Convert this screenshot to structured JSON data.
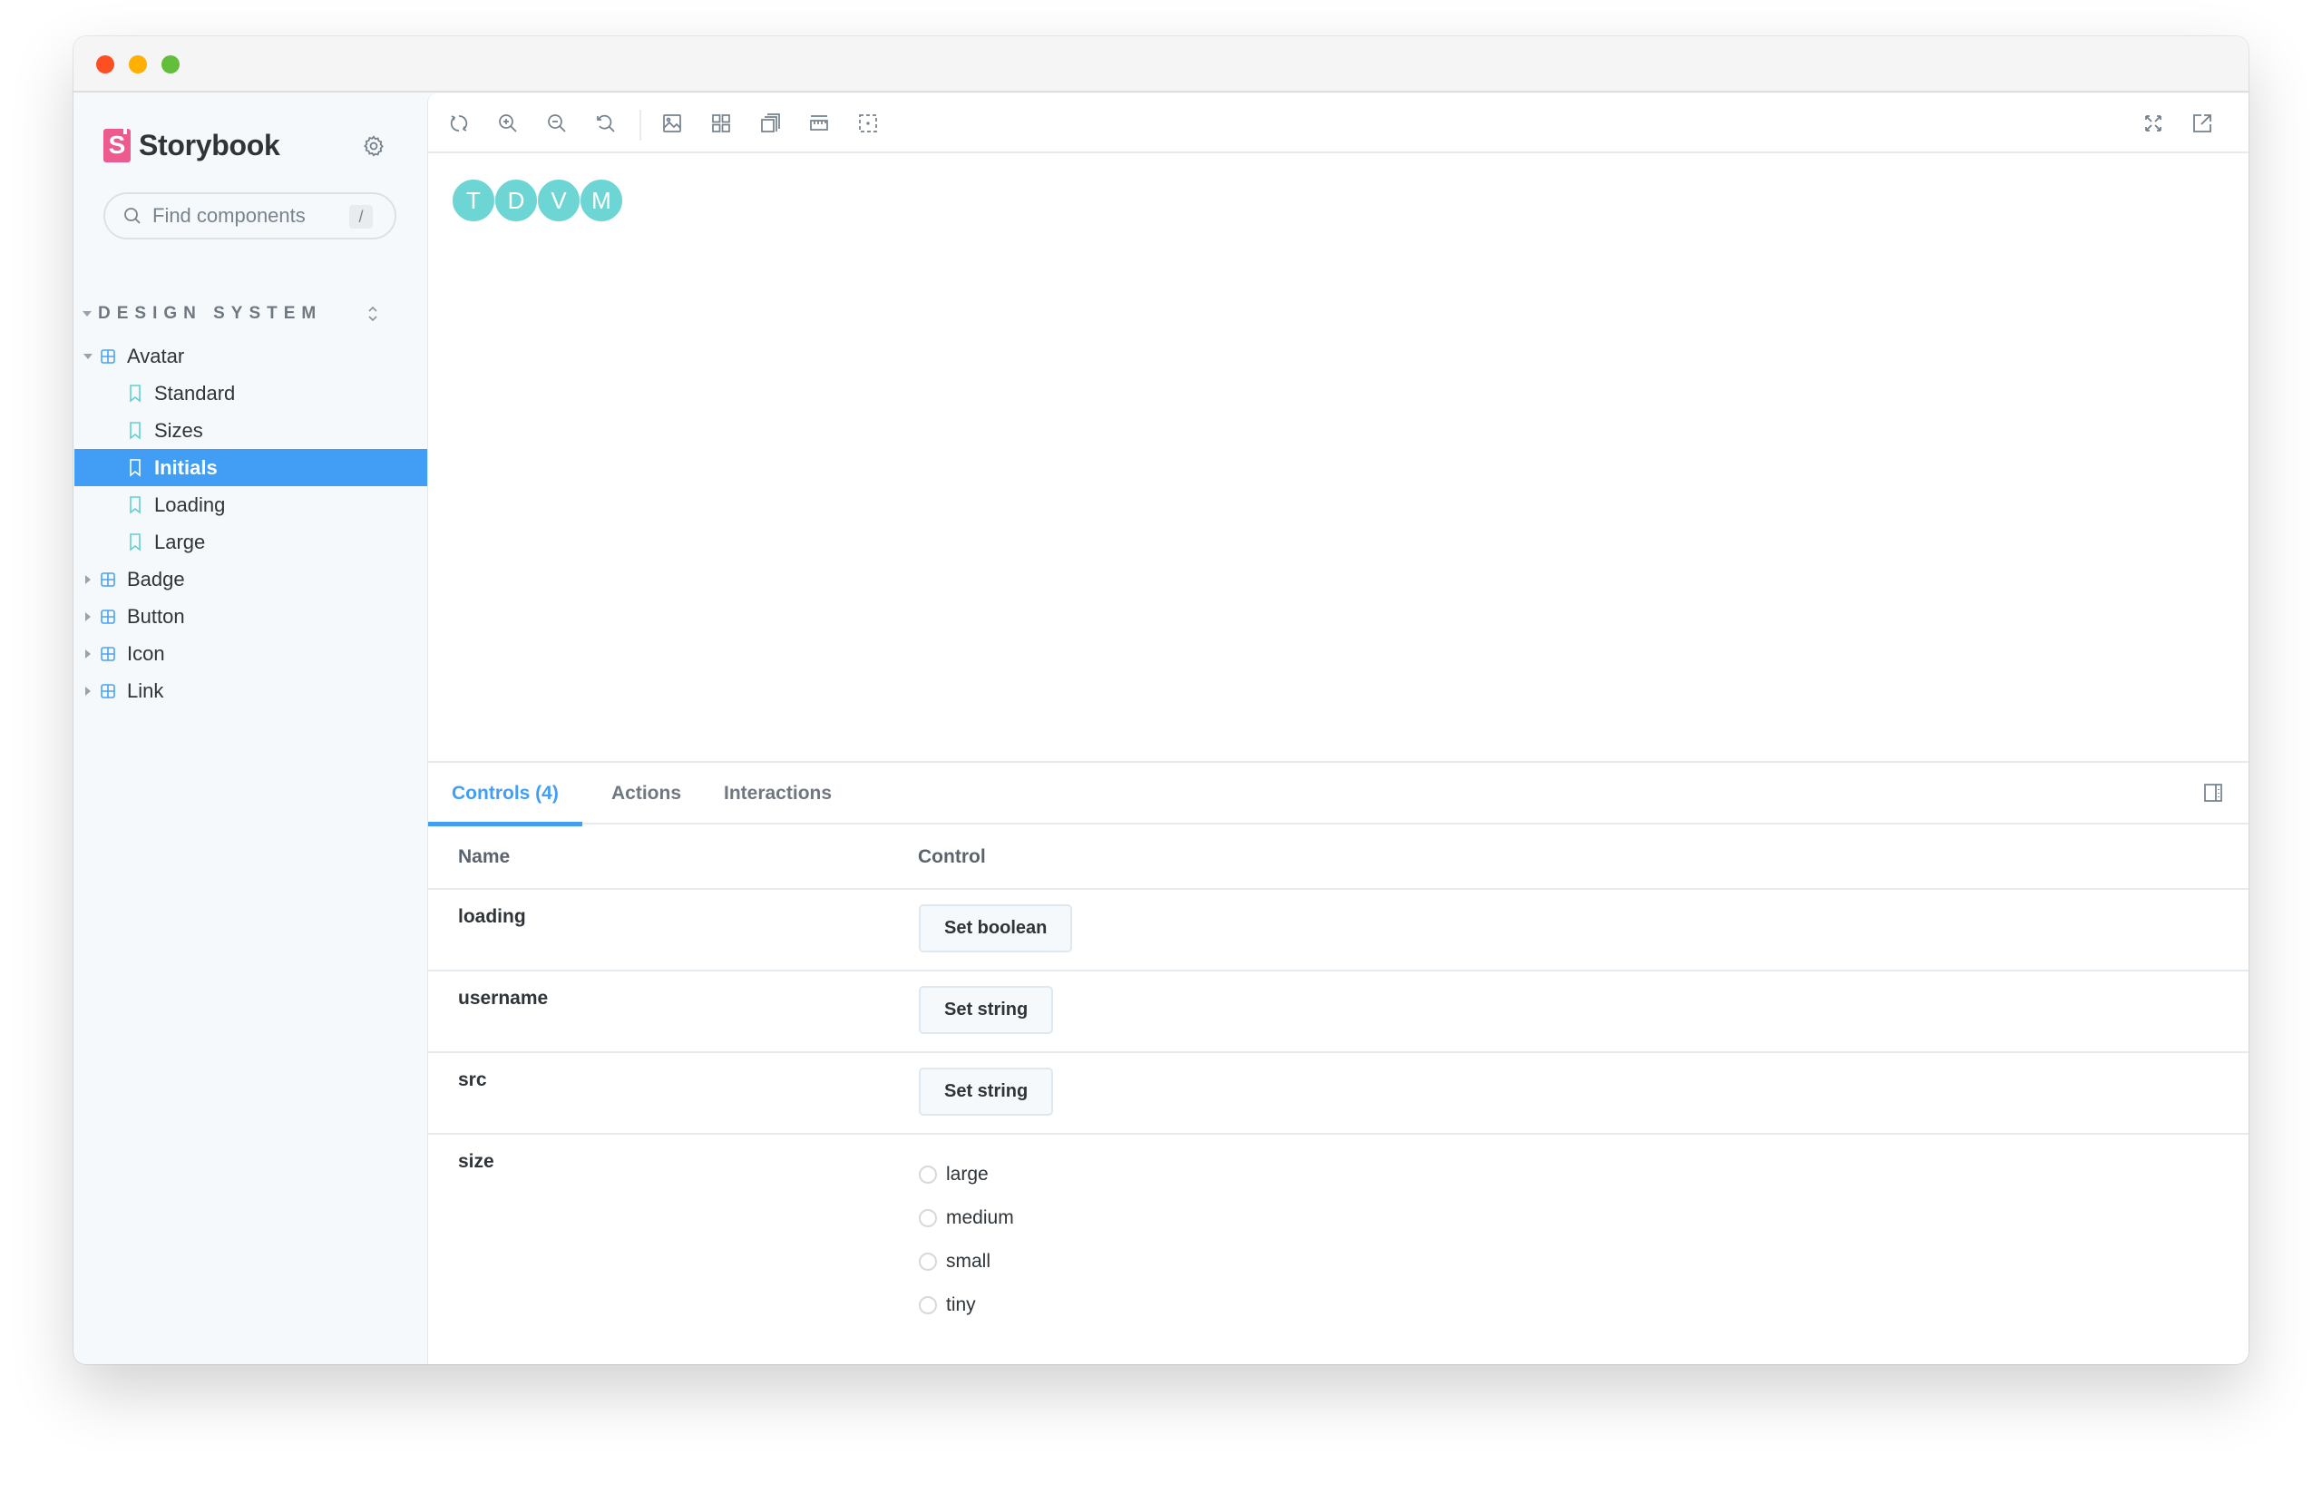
{
  "window": {
    "controls": [
      "close",
      "minimize",
      "maximize"
    ]
  },
  "sidebar": {
    "brand": {
      "logo_letter": "S",
      "name": "Storybook"
    },
    "settings_icon": "gear-icon",
    "search": {
      "placeholder": "Find components",
      "value": "",
      "shortcut": "/"
    },
    "section": {
      "title": "DESIGN SYSTEM",
      "expanded": true
    },
    "tree": [
      {
        "type": "component",
        "label": "Avatar",
        "expanded": true
      },
      {
        "type": "story",
        "label": "Standard",
        "selected": false
      },
      {
        "type": "story",
        "label": "Sizes",
        "selected": false
      },
      {
        "type": "story",
        "label": "Initials",
        "selected": true
      },
      {
        "type": "story",
        "label": "Loading",
        "selected": false
      },
      {
        "type": "story",
        "label": "Large",
        "selected": false
      },
      {
        "type": "component",
        "label": "Badge",
        "expanded": false
      },
      {
        "type": "component",
        "label": "Button",
        "expanded": false
      },
      {
        "type": "component",
        "label": "Icon",
        "expanded": false
      },
      {
        "type": "component",
        "label": "Link",
        "expanded": false
      }
    ]
  },
  "toolbar": {
    "left_tools": [
      "remount-icon",
      "zoom-in-icon",
      "zoom-out-icon",
      "zoom-reset-icon",
      "background-icon",
      "grid-icon",
      "viewport-icon",
      "measure-icon",
      "outline-icon"
    ],
    "right_tools": [
      "fullscreen-icon",
      "open-new-tab-icon"
    ]
  },
  "preview": {
    "avatars": [
      "T",
      "D",
      "V",
      "M"
    ],
    "avatar_color": "#6ed5d5"
  },
  "addons": {
    "tabs": [
      {
        "label": "Controls (4)",
        "active": true
      },
      {
        "label": "Actions",
        "active": false
      },
      {
        "label": "Interactions",
        "active": false
      }
    ],
    "accent": "#429ef5",
    "table": {
      "headers": {
        "name": "Name",
        "control": "Control"
      },
      "rows": [
        {
          "name": "loading",
          "control": "Set boolean"
        },
        {
          "name": "username",
          "control": "Set string"
        },
        {
          "name": "src",
          "control": "Set string"
        },
        {
          "name": "size",
          "options": [
            "large",
            "medium",
            "small",
            "tiny"
          ],
          "selected": null
        }
      ]
    }
  }
}
